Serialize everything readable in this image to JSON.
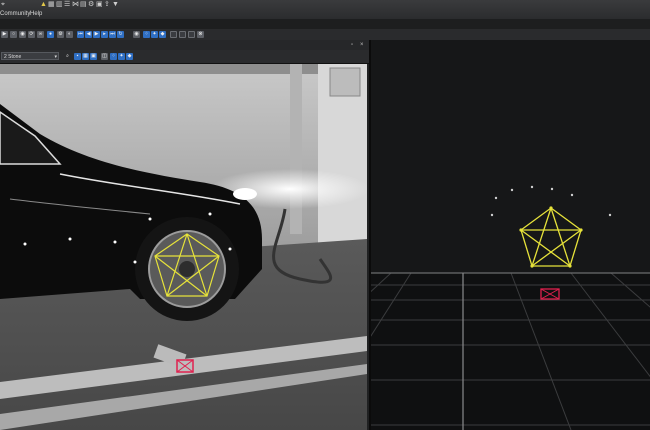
{
  "menu": {
    "items": [
      "Community",
      "Help"
    ]
  },
  "camera_pane": {
    "selected_camera": "2 Stone"
  }
}
